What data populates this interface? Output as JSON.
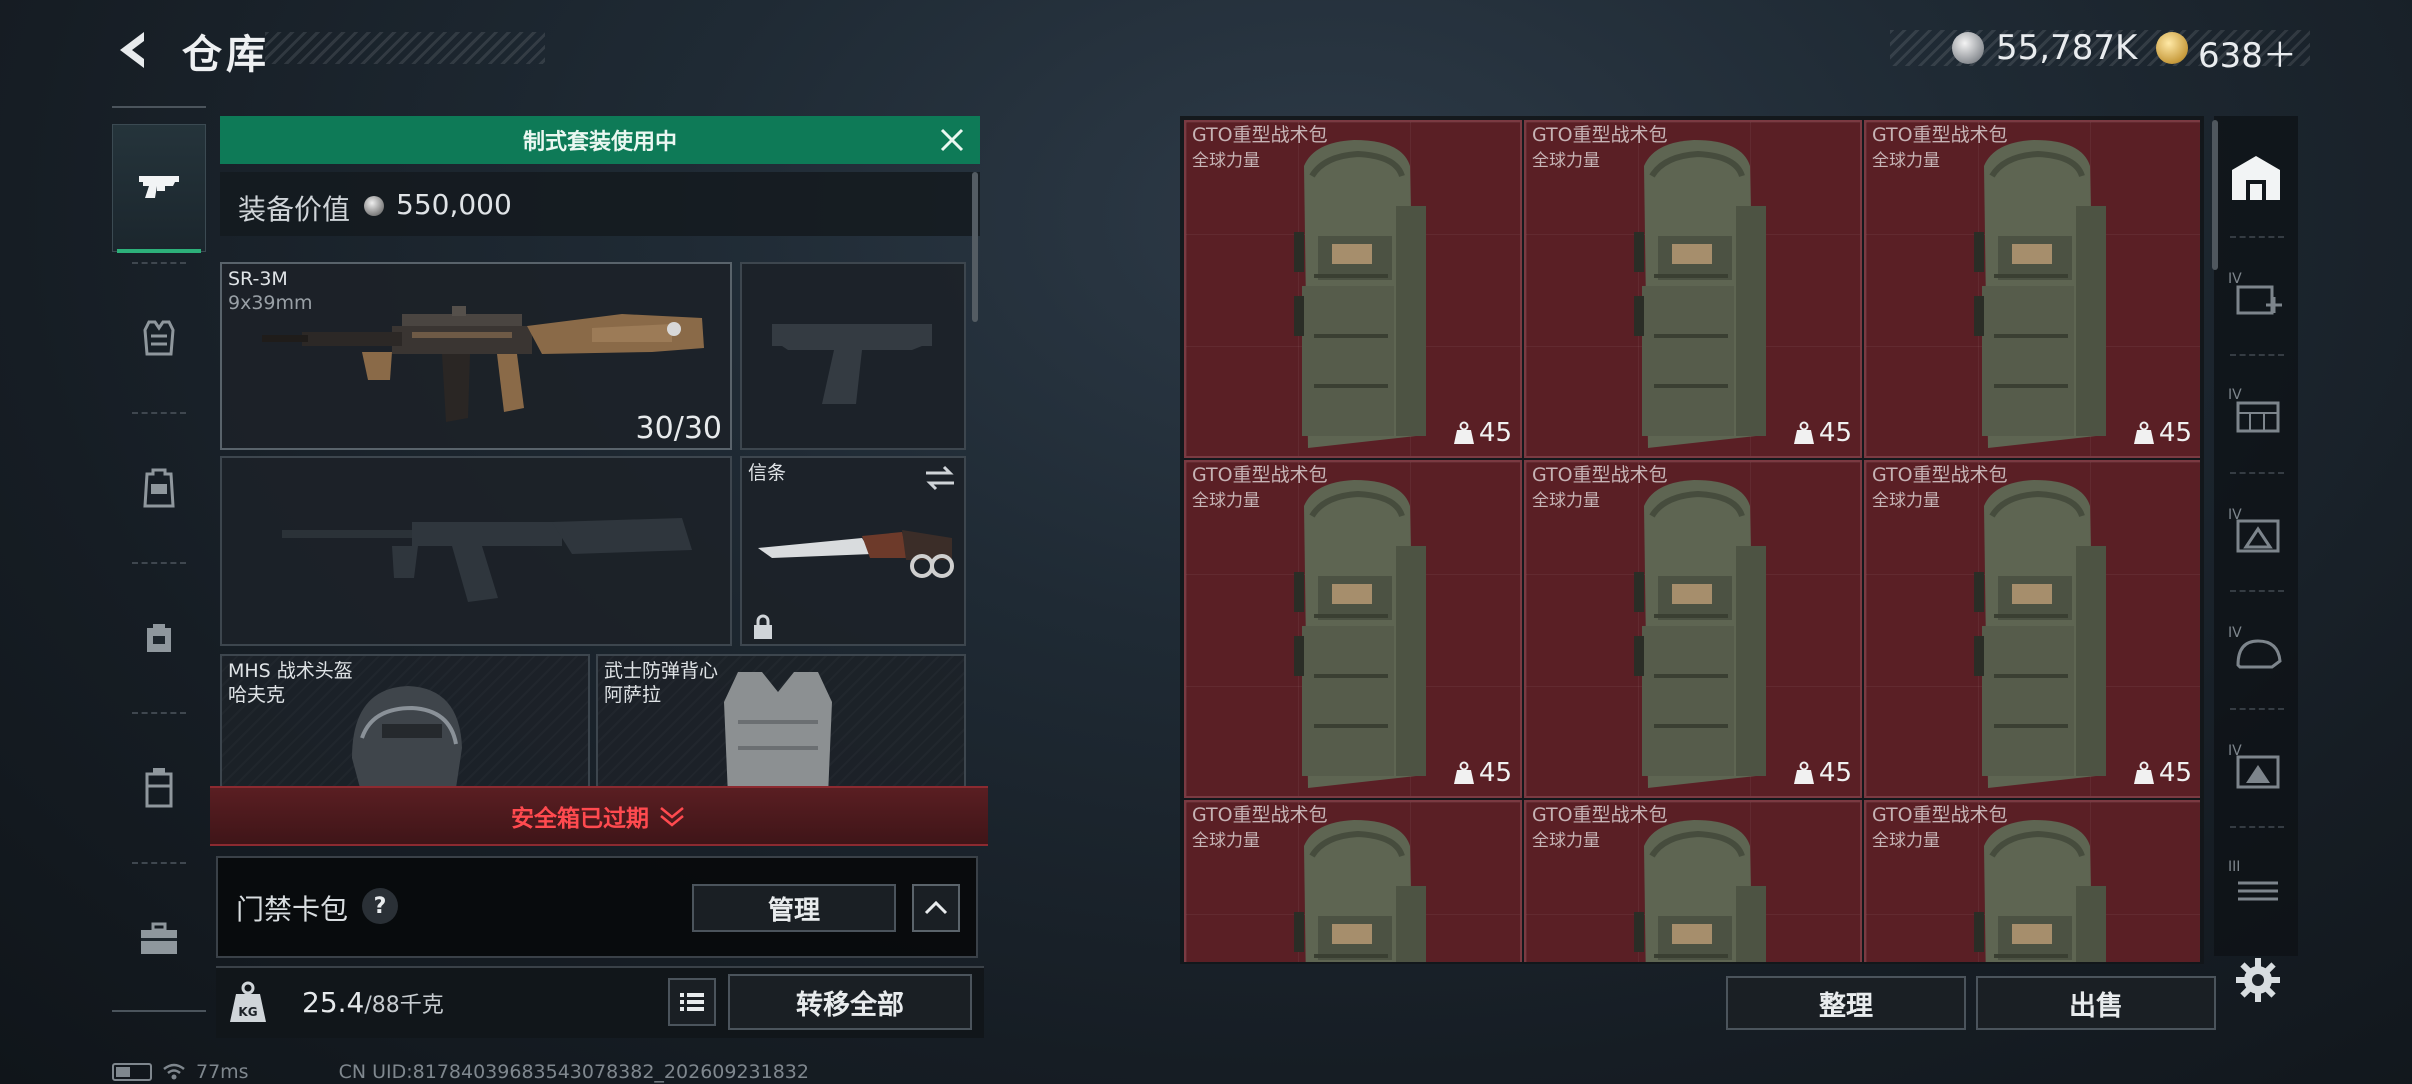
{
  "header": {
    "title": "仓库",
    "currency": [
      {
        "name": "coin-silver",
        "value": "55,787K"
      },
      {
        "name": "coin-gold",
        "value": "638＋"
      }
    ]
  },
  "left_nav": {
    "items": [
      "pistol-icon",
      "vest-icon",
      "backpack-icon",
      "bag-icon",
      "case-icon",
      "toolbox-icon"
    ],
    "active": "pistol-icon"
  },
  "equipment": {
    "banner": "制式套装使用中",
    "value_label": "装备价值",
    "value": "550,000",
    "primary": {
      "name": "SR-3M",
      "caliber": "9x39mm",
      "ammo": "30/30"
    },
    "melee": {
      "name": "信条"
    },
    "helmet": {
      "name": "MHS 战术头盔",
      "brand": "哈夫克"
    },
    "armor": {
      "name": "武士防弹背心",
      "brand": "阿萨拉"
    },
    "safe_box_status": "安全箱已过期",
    "keycard_label": "门禁卡包",
    "help_label": "?",
    "manage_label": "管理",
    "weight_value": "25.4",
    "weight_capacity": "/88千克",
    "weight_icon_label": "KG",
    "transfer_all_label": "转移全部"
  },
  "storage": {
    "items": [
      {
        "name": "GTO重型战术包",
        "brand": "全球力量",
        "weight": "45"
      },
      {
        "name": "GTO重型战术包",
        "brand": "全球力量",
        "weight": "45"
      },
      {
        "name": "GTO重型战术包",
        "brand": "全球力量",
        "weight": "45"
      },
      {
        "name": "GTO重型战术包",
        "brand": "全球力量",
        "weight": "45"
      },
      {
        "name": "GTO重型战术包",
        "brand": "全球力量",
        "weight": "45"
      },
      {
        "name": "GTO重型战术包",
        "brand": "全球力量",
        "weight": "45"
      },
      {
        "name": "GTO重型战术包",
        "brand": "全球力量",
        "weight": ""
      },
      {
        "name": "GTO重型战术包",
        "brand": "全球力量",
        "weight": ""
      },
      {
        "name": "GTO重型战术包",
        "brand": "全球力量",
        "weight": ""
      }
    ],
    "organize_label": "整理",
    "sell_label": "出售",
    "item_bg_color": "#5a1f25"
  },
  "right_rail": {
    "items": [
      "warehouse-icon",
      "tier-iv-medkit-icon",
      "tier-iv-storage-icon",
      "tier-iv-armor-icon",
      "tier-iv-helmet-icon",
      "tier-iv-armor-alt-icon",
      "tier-iii-storage-icon"
    ],
    "tier_labels": [
      "IV",
      "IV",
      "IV",
      "IV",
      "IV",
      "III"
    ]
  },
  "status": {
    "ping": "77ms",
    "uid": "CN UID:81784039683543078382_202609231832"
  },
  "colors": {
    "accent_green": "#0e7a57",
    "warning_red": "#ff4a4f"
  }
}
